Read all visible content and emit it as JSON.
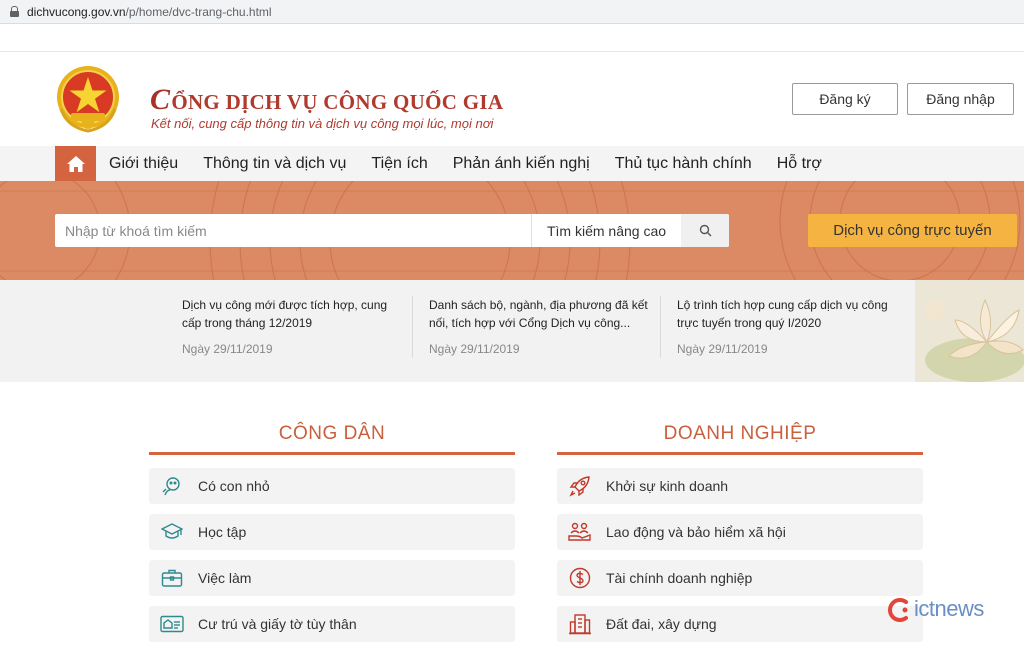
{
  "browser": {
    "url_domain": "dichvucong.gov.vn",
    "url_path": "/p/home/dvc-trang-chu.html"
  },
  "header": {
    "title_initial": "C",
    "title_rest": "ỔNG DỊCH VỤ CÔNG QUỐC GIA",
    "subtitle": "Kết nối, cung cấp thông tin và dịch vụ công mọi lúc, mọi nơi",
    "register_label": "Đăng ký",
    "login_label": "Đăng nhập"
  },
  "nav": {
    "items": [
      {
        "label": "Giới thiệu"
      },
      {
        "label": "Thông tin và dịch vụ"
      },
      {
        "label": "Tiện ích"
      },
      {
        "label": "Phản ánh kiến nghị"
      },
      {
        "label": "Thủ tục hành chính"
      },
      {
        "label": "Hỗ trợ"
      }
    ]
  },
  "search": {
    "placeholder": "Nhập từ khoá tìm kiếm",
    "advanced_label": "Tìm kiếm nâng cao",
    "online_services_label": "Dịch vụ công trực tuyến"
  },
  "news": [
    {
      "title": "Dịch vụ công mới được tích hợp, cung cấp trong tháng 12/2019",
      "date": "Ngày 29/11/2019"
    },
    {
      "title": "Danh sách bộ, ngành, địa phương đã kết nối, tích hợp với Cổng Dịch vụ công...",
      "date": "Ngày 29/11/2019"
    },
    {
      "title": "Lộ trình tích hợp cung cấp dịch vụ công trực tuyến trong quý I/2020",
      "date": "Ngày 29/11/2019"
    }
  ],
  "citizen": {
    "title": "CÔNG DÂN",
    "items": [
      {
        "label": "Có con nhỏ",
        "icon": "baby-icon"
      },
      {
        "label": "Học tập",
        "icon": "graduation-cap-icon"
      },
      {
        "label": "Việc làm",
        "icon": "briefcase-icon"
      },
      {
        "label": "Cư trú và giấy tờ tùy thân",
        "icon": "id-card-icon"
      }
    ]
  },
  "business": {
    "title": "DOANH NGHIỆP",
    "items": [
      {
        "label": "Khởi sự kinh doanh",
        "icon": "rocket-icon"
      },
      {
        "label": "Lao động và bảo hiểm xã hội",
        "icon": "people-hand-icon"
      },
      {
        "label": "Tài chính doanh nghiệp",
        "icon": "dollar-icon"
      },
      {
        "label": "Đất đai, xây dựng",
        "icon": "building-icon"
      }
    ]
  },
  "watermark": {
    "text": "ictnews"
  },
  "colors": {
    "accent": "#d3643f",
    "title_red": "#b03a2e",
    "banner": "#dc8a63",
    "online_button": "#f5b441"
  }
}
